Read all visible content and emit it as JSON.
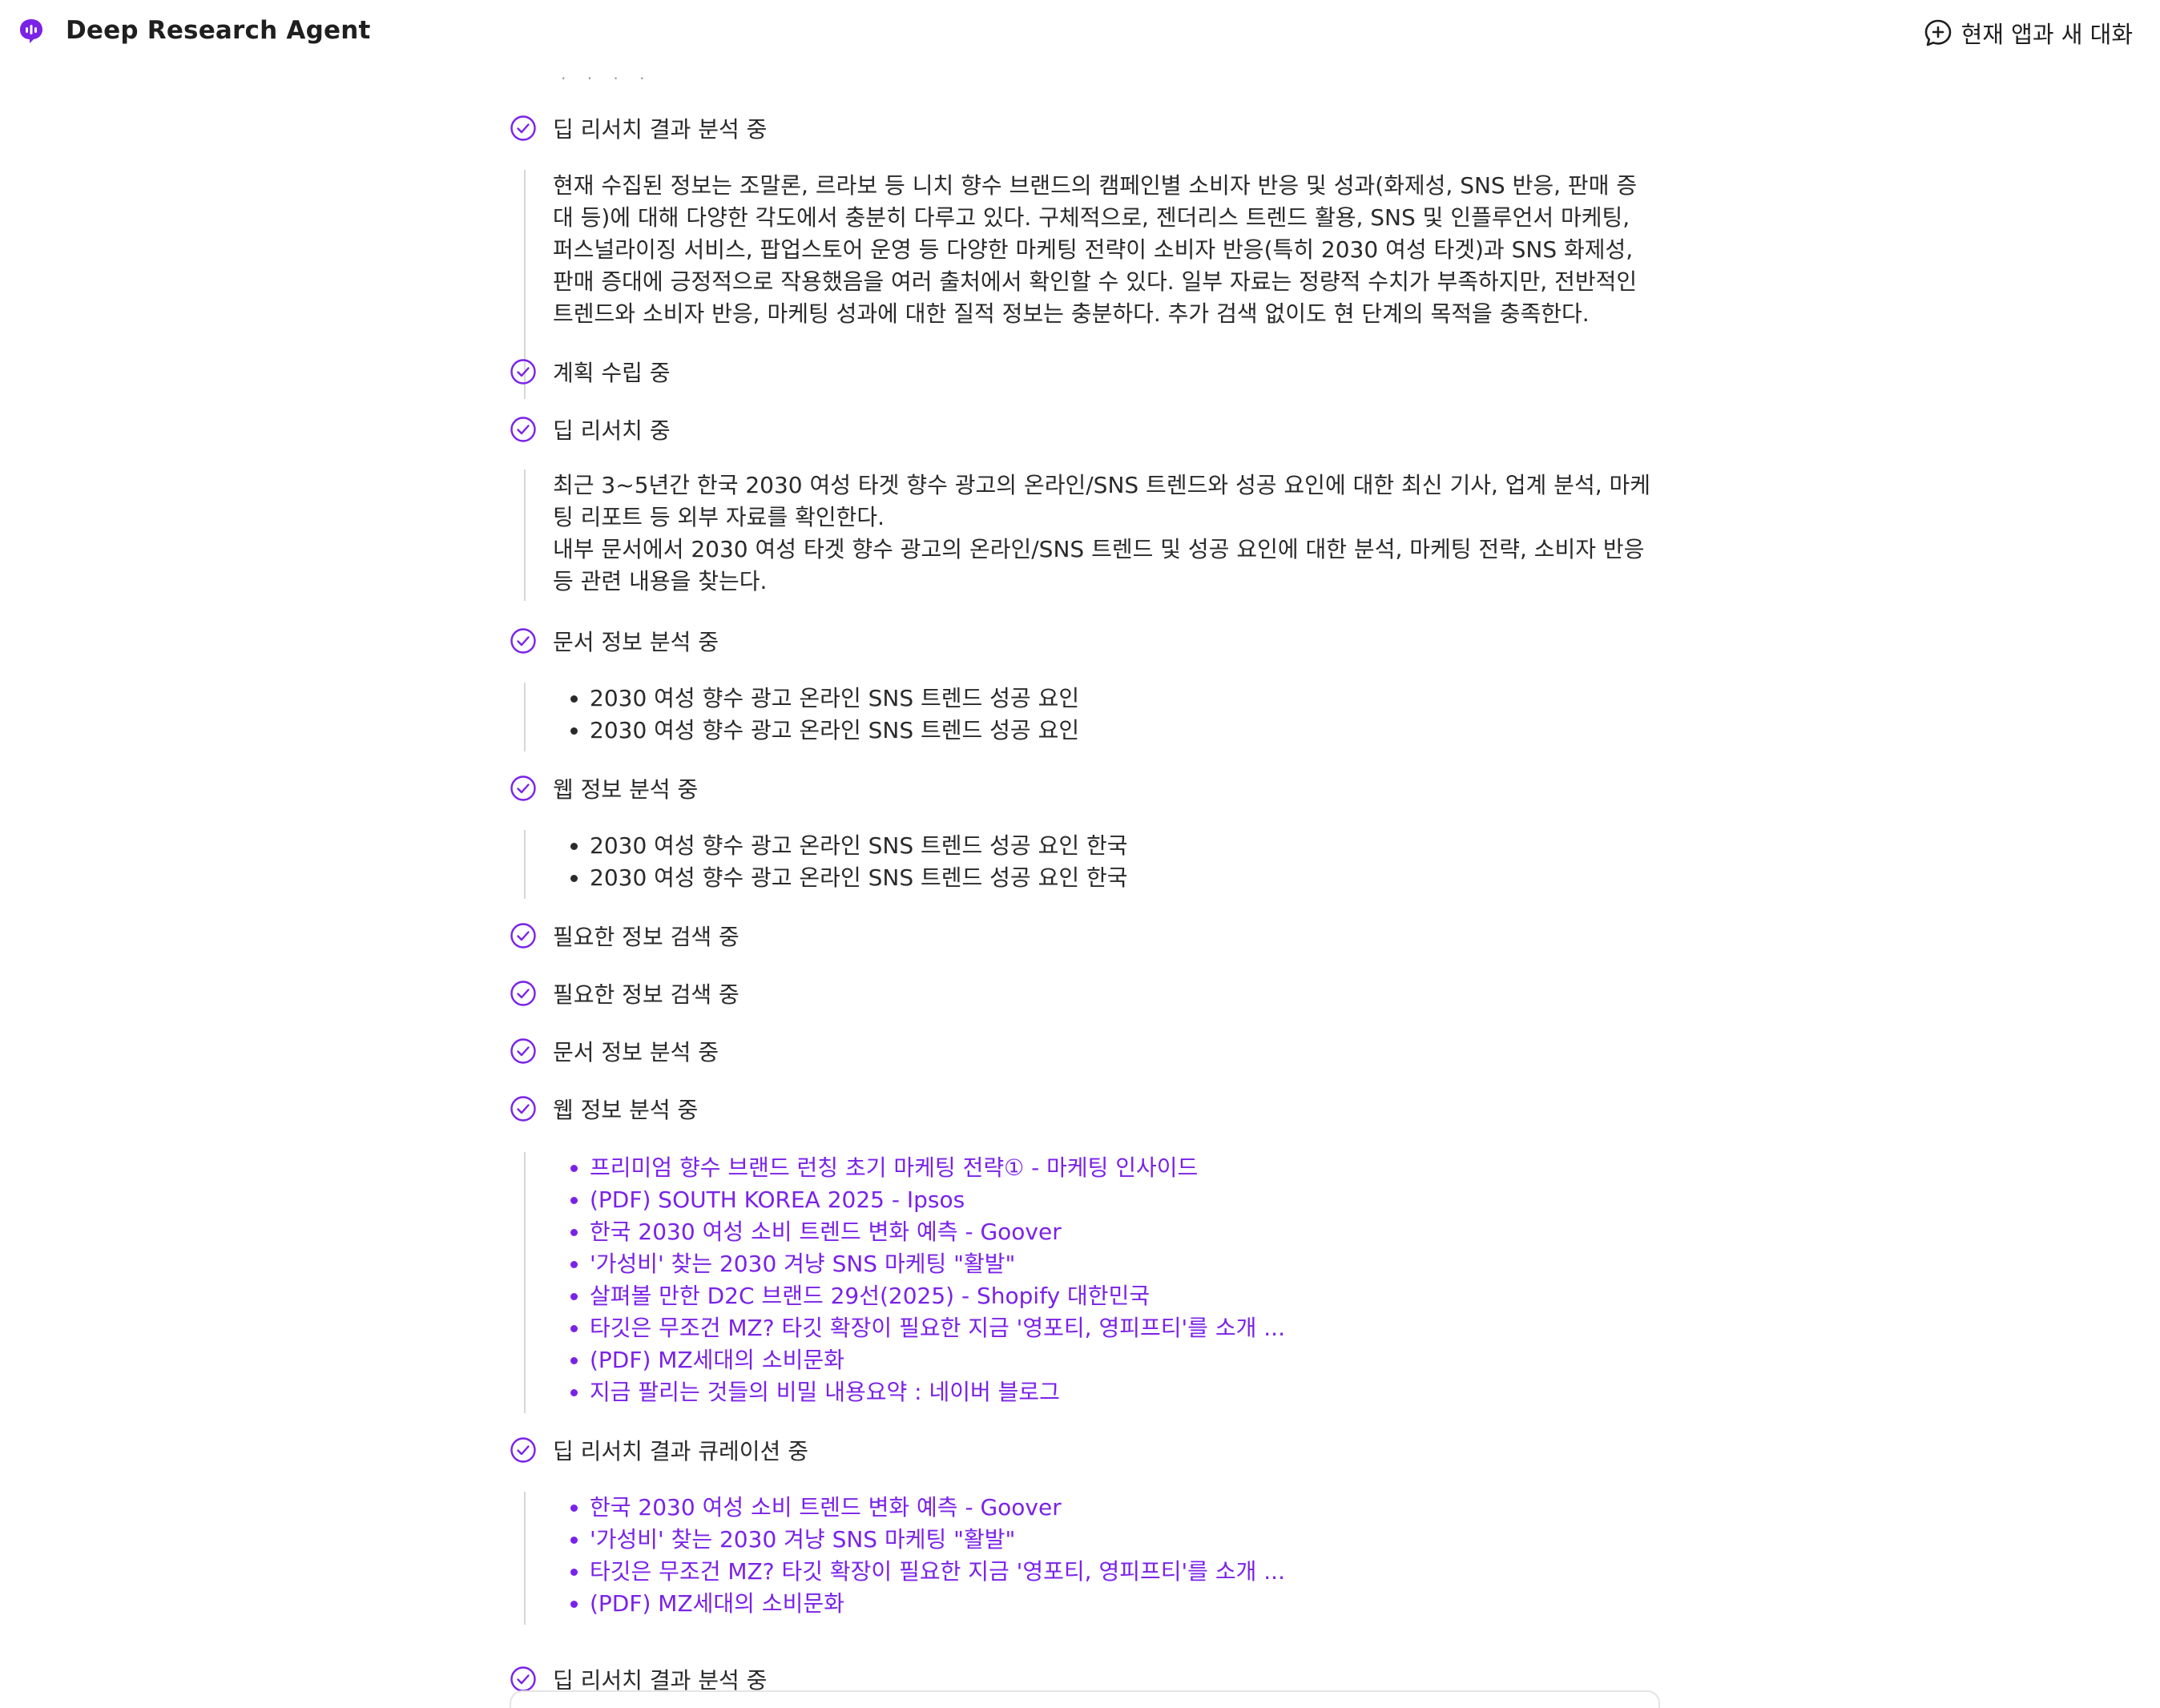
{
  "app": {
    "title": "Deep Research Agent",
    "new_chat_label": "현재 앱과 새 대화",
    "accent_color": "#7a22e8"
  },
  "clipped_top_text": "· · · ·",
  "steps": [
    {
      "label": "딥 리서치 결과 분석 중",
      "icon": "check-circle-icon"
    },
    {
      "label": "계획 수립 중",
      "icon": "check-circle-icon"
    },
    {
      "label": "딥 리서치 중",
      "icon": "check-circle-icon"
    },
    {
      "label": "문서 정보 분석 중",
      "icon": "check-circle-icon"
    },
    {
      "label": "웹 정보 분석 중",
      "icon": "check-circle-icon"
    },
    {
      "label": "필요한 정보 검색 중",
      "icon": "check-circle-icon"
    },
    {
      "label": "필요한 정보 검색 중",
      "icon": "check-circle-icon"
    },
    {
      "label": "문서 정보 분석 중",
      "icon": "check-circle-icon"
    },
    {
      "label": "웹 정보 분석 중",
      "icon": "check-circle-icon"
    },
    {
      "label": "딥 리서치 결과 큐레이션 중",
      "icon": "check-circle-icon"
    },
    {
      "label": "딥 리서치 결과 분석 중",
      "icon": "check-circle-icon"
    }
  ],
  "details": {
    "analysis_summary": "현재 수집된 정보는 조말론, 르라보 등 니치 향수 브랜드의 캠페인별 소비자 반응 및 성과(화제성, SNS 반응, 판매 증대 등)에 대해 다양한 각도에서 충분히 다루고 있다. 구체적으로, 젠더리스 트렌드 활용, SNS 및 인플루언서 마케팅, 퍼스널라이징 서비스, 팝업스토어 운영 등 다양한 마케팅 전략이 소비자 반응(특히 2030 여성 타겟)과 SNS 화제성, 판매 증대에 긍정적으로 작용했음을 여러 출처에서 확인할 수 있다. 일부 자료는 정량적 수치가 부족하지만, 전반적인 트렌드와 소비자 반응, 마케팅 성과에 대한 질적 정보는 충분하다. 추가 검색 없이도 현 단계의 목적을 충족한다.",
    "research_line_1": "최근 3~5년간 한국 2030 여성 타겟 향수 광고의 온라인/SNS 트렌드와 성공 요인에 대한 최신 기사, 업계 분석, 마케팅 리포트 등 외부 자료를 확인한다.",
    "research_line_2": "내부 문서에서 2030 여성 타겟 향수 광고의 온라인/SNS 트렌드 및 성공 요인에 대한 분석, 마케팅 전략, 소비자 반응 등 관련 내용을 찾는다.",
    "doc_queries": [
      "2030 여성 향수 광고 온라인 SNS 트렌드 성공 요인",
      "2030 여성 향수 광고 온라인 SNS 트렌드 성공 요인"
    ],
    "web_queries": [
      "2030 여성 향수 광고 온라인 SNS 트렌드 성공 요인 한국",
      "2030 여성 향수 광고 온라인 SNS 트렌드 성공 요인 한국"
    ],
    "web_results": [
      "프리미엄 향수 브랜드 런칭 초기 마케팅 전략① - 마케팅 인사이드",
      "(PDF) SOUTH KOREA 2025 - Ipsos",
      "한국 2030 여성 소비 트렌드 변화 예측 - Goover",
      "'가성비' 찾는 2030 겨냥 SNS 마케팅 \"활발\"",
      "살펴볼 만한 D2C 브랜드 29선(2025) - Shopify 대한민국",
      "타깃은 무조건 MZ? 타깃 확장이 필요한 지금 '영포티, 영피프티'를 소개 ...",
      "(PDF) MZ세대의 소비문화",
      "지금 팔리는 것들의 비밀 내용요약 : 네이버 블로그"
    ],
    "curated_results": [
      "한국 2030 여성 소비 트렌드 변화 예측 - Goover",
      "'가성비' 찾는 2030 겨냥 SNS 마케팅 \"활발\"",
      "타깃은 무조건 MZ? 타깃 확장이 필요한 지금 '영포티, 영피프티'를 소개 ...",
      "(PDF) MZ세대의 소비문화"
    ]
  }
}
